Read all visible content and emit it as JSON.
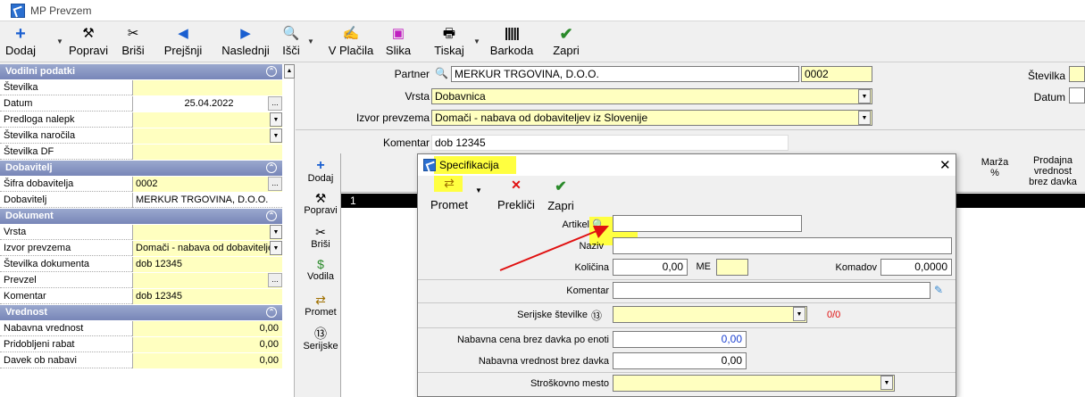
{
  "window": {
    "title": "MP Prevzem"
  },
  "toolbar": {
    "add": "Dodaj",
    "edit": "Popravi",
    "delete": "Briši",
    "prev": "Prejšnji",
    "next": "Naslednji",
    "search": "Išči",
    "v_placila": "V Plačila",
    "image": "Slika",
    "print": "Tiskaj",
    "barcode": "Barkoda",
    "close": "Zapri"
  },
  "left_panel": {
    "sec_vodilni": "Vodilni podatki",
    "stevilka": "Številka",
    "datum": "Datum",
    "datum_val": "25.04.2022",
    "predloga": "Predloga nalepk",
    "st_narocila": "Številka naročila",
    "st_df": "Številka DF",
    "sec_dobavitelj": "Dobavitelj",
    "sifra_dob": "Šifra dobavitelja",
    "sifra_dob_val": "0002",
    "dobavitelj": "Dobavitelj",
    "dobavitelj_val": "MERKUR TRGOVINA, D.O.O.",
    "sec_dokument": "Dokument",
    "vrsta": "Vrsta",
    "izvor": "Izvor prevzema",
    "izvor_val": "Domači - nabava od dobavitelje",
    "st_dok": "Številka dokumenta",
    "st_dok_val": "dob 12345",
    "prevzel": "Prevzel",
    "komentar": "Komentar",
    "komentar_val": "dob 12345",
    "sec_vrednost": "Vrednost",
    "nab_vred": "Nabavna vrednost",
    "nab_vred_val": "0,00",
    "rabat": "Pridobljeni rabat",
    "rabat_val": "0,00",
    "davek": "Davek ob nabavi",
    "davek_val": "0,00"
  },
  "form": {
    "partner": "Partner",
    "partner_val": "MERKUR TRGOVINA, D.O.O.",
    "partner_code": "0002",
    "vrsta": "Vrsta",
    "vrsta_val": "Dobavnica",
    "izvor": "Izvor prevzema",
    "izvor_val": "Domači - nabava od dobaviteljev iz Slovenije",
    "komentar": "Komentar",
    "komentar_val": "dob 12345",
    "stevilka": "Številka",
    "datum": "Datum"
  },
  "side": {
    "add": "Dodaj",
    "edit": "Popravi",
    "delete": "Briši",
    "vodila": "Vodila",
    "promet": "Promet",
    "serijske": "Serijske"
  },
  "grid": {
    "marza": "Marža",
    "marza2": "%",
    "prod1": "Prodajna",
    "prod2": "vrednost",
    "prod3": "brez davka",
    "row1": "1"
  },
  "dialog": {
    "title": "Specifikacija",
    "promet": "Promet",
    "preklici": "Prekliči",
    "zapri": "Zapri",
    "artikel": "Artikel",
    "naziv": "Naziv",
    "kolicina": "Količina",
    "kolicina_val": "0,00",
    "me": "ME",
    "komadov": "Komadov",
    "komadov_val": "0,0000",
    "komentar": "Komentar",
    "serijske": "Serijske številke",
    "serijske_count": "0/0",
    "nab_cena": "Nabavna cena brez davka po enoti",
    "nab_cena_val": "0,00",
    "nab_vred": "Nabavna vrednost brez davka",
    "nab_vred_val": "0,00",
    "strosk": "Stroškovno mesto"
  },
  "colors": {
    "highlight": "#ffff40",
    "field_yellow": "#ffffc0",
    "arrow": "#e01010"
  }
}
